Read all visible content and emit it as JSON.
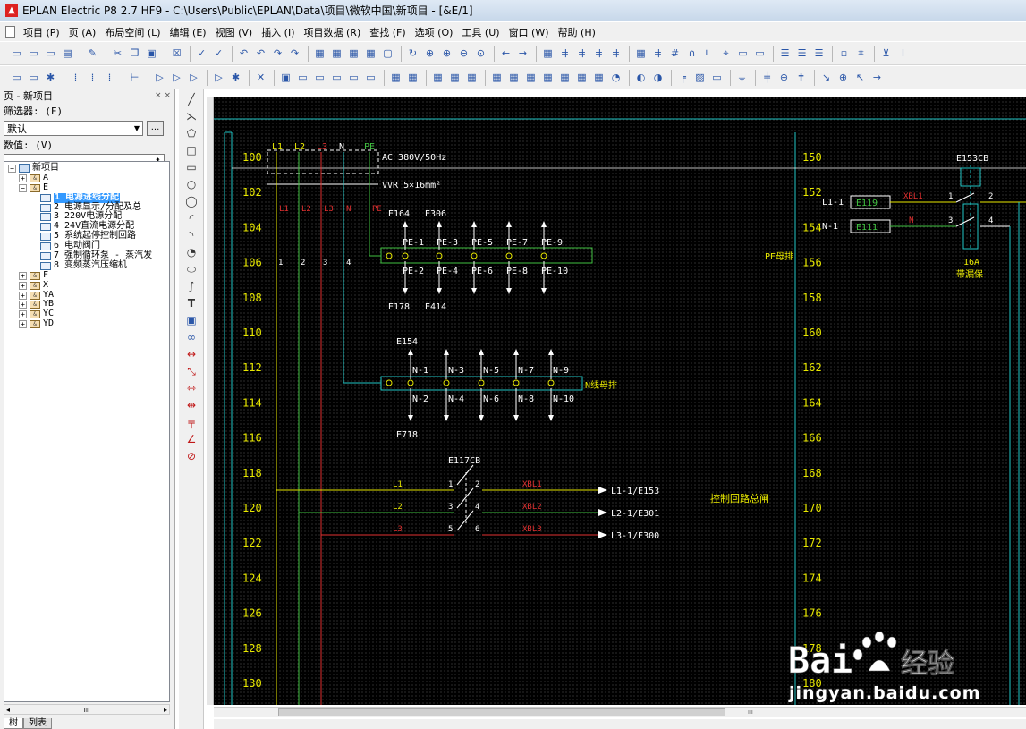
{
  "window": {
    "title": "EPLAN Electric P8 2.7 HF9 - C:\\Users\\Public\\EPLAN\\Data\\项目\\微软中国\\新项目 - [&E/1]"
  },
  "menu": [
    "项目 (P)",
    "页 (A)",
    "布局空间 (L)",
    "编辑 (E)",
    "视图 (V)",
    "插入 (I)",
    "项目数据 (R)",
    "查找 (F)",
    "选项 (O)",
    "工具 (U)",
    "窗口 (W)",
    "帮助 (H)"
  ],
  "left_panel": {
    "title": "页 - 新项目",
    "close_icon": "× ×",
    "filter_label": "筛选器: (F)",
    "filter_value": "默认",
    "filter_button": "...",
    "value_label": "数值: (V)",
    "value_input": "",
    "tree": {
      "root": "新项目",
      "before": [
        "A"
      ],
      "open_node": "E",
      "pages": [
        "1 电源进线分配",
        "2 电源显示/分配及总",
        "3 220V电源分配",
        "4 24V直流电源分配",
        "5 系统起停控制回路",
        "6 电动阀门",
        "7 强制循环泵 - 蒸汽发",
        "8 变频蒸汽压缩机"
      ],
      "after": [
        "F",
        "X",
        "YA",
        "YB",
        "YC",
        "YD"
      ]
    },
    "scroll_arrows": [
      "◂",
      "ııı",
      "▸"
    ],
    "tabs": [
      "树",
      "列表"
    ]
  },
  "schematic": {
    "rows_left": [
      "100",
      "102",
      "104",
      "106",
      "108",
      "110",
      "112",
      "114",
      "116",
      "118",
      "120",
      "122",
      "124",
      "126",
      "128",
      "130"
    ],
    "rows_right": [
      "150",
      "152",
      "154",
      "156",
      "158",
      "160",
      "162",
      "164",
      "166",
      "168",
      "170",
      "172",
      "174",
      "176",
      "178",
      "180"
    ],
    "supply_labels": [
      "L1",
      "L2",
      "L3",
      "N",
      "PE"
    ],
    "supply_text": "AC 380V/50Hz",
    "cable_text": "VVR 5×16mm²",
    "drop_labels": [
      "L1",
      "L2",
      "L3",
      "N",
      "PE"
    ],
    "drop_numbers": [
      "1",
      "2",
      "3",
      "4"
    ],
    "pe_top_refs": [
      "E164",
      "E306"
    ],
    "pe_bottom_refs": [
      "E178",
      "E414"
    ],
    "pe_top_labels": [
      "PE-1",
      "PE-3",
      "PE-5",
      "PE-7",
      "PE-9"
    ],
    "pe_bottom_labels": [
      "PE-2",
      "PE-4",
      "PE-6",
      "PE-8",
      "PE-10"
    ],
    "pe_bar_label": "PE母排",
    "n_top_ref": "E154",
    "n_bottom_ref": "E718",
    "n_top_labels": [
      "N-1",
      "N-3",
      "N-5",
      "N-7",
      "N-9"
    ],
    "n_bottom_labels": [
      "N-2",
      "N-4",
      "N-6",
      "N-8",
      "N-10"
    ],
    "n_bar_label": "N线母排",
    "breaker_ref": "E117CB",
    "breaker_wires_left": [
      "L1",
      "L2",
      "L3"
    ],
    "breaker_pins_left": [
      "1",
      "3",
      "5"
    ],
    "breaker_pins_right": [
      "2",
      "4",
      "6"
    ],
    "breaker_wires_right": [
      "XBL1",
      "XBL2",
      "XBL3"
    ],
    "targets": [
      "L1-1/E153",
      "L2-1/E301",
      "L3-1/E300"
    ],
    "control_label": "控制回路总闸",
    "right_breaker_ref": "E153CB",
    "right_refs": [
      "L1-1",
      "N-1"
    ],
    "right_boxes": [
      "E119",
      "E111"
    ],
    "right_wires": [
      "XBL1",
      "N"
    ],
    "right_pins": [
      "1",
      "2",
      "3",
      "4"
    ],
    "rating": "16A",
    "rating_desc": "带漏保"
  },
  "watermark": {
    "text": "jingyan.baidu.com",
    "brand": "Bai",
    "brand2": "经验"
  }
}
